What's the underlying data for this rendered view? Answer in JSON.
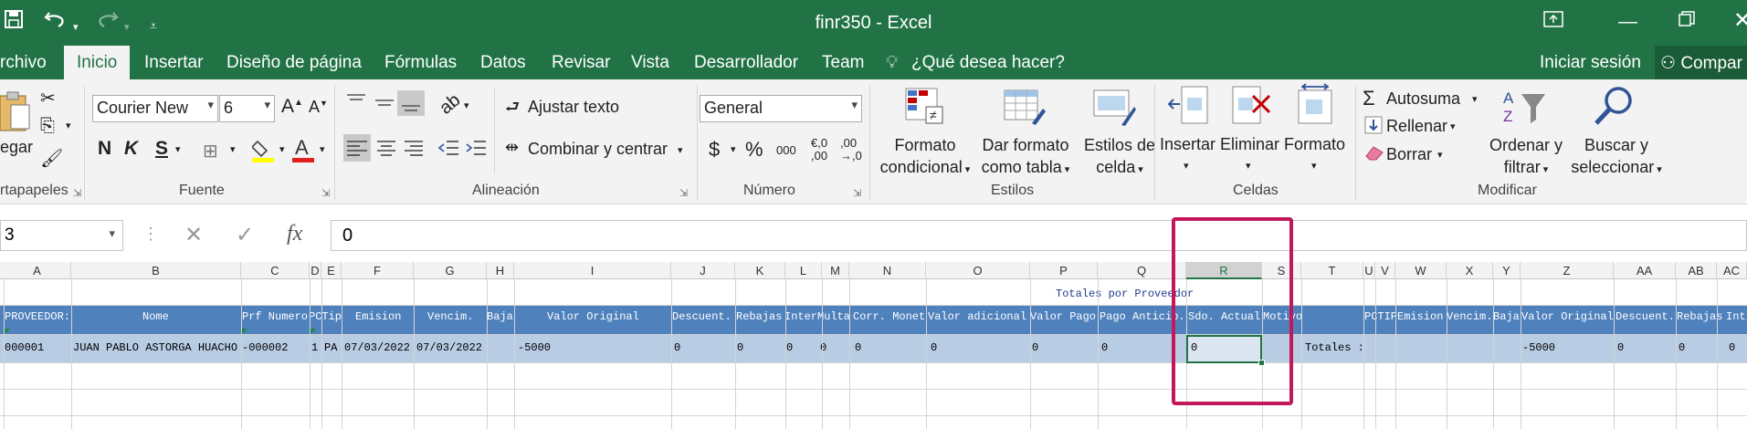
{
  "window": {
    "title": "finr350 - Excel"
  },
  "qat": {
    "save_icon": "save-icon",
    "undo_icon": "undo-icon",
    "redo_icon": "redo-icon",
    "customize_icon": "customize-qat-icon"
  },
  "tabs": [
    {
      "label": "rchivo"
    },
    {
      "label": "Inicio"
    },
    {
      "label": "Insertar"
    },
    {
      "label": "Diseño de página"
    },
    {
      "label": "Fórmulas"
    },
    {
      "label": "Datos"
    },
    {
      "label": "Revisar"
    },
    {
      "label": "Vista"
    },
    {
      "label": "Desarrollador"
    },
    {
      "label": "Team"
    },
    {
      "label": "¿Qué desea hacer?"
    }
  ],
  "account": {
    "signin": "Iniciar sesión",
    "share": "Compar"
  },
  "ribbon": {
    "clipboard": {
      "paste": "egar",
      "label": "rtapapeles"
    },
    "font": {
      "name": "Courier New",
      "size": "6",
      "bold": "N",
      "italic": "K",
      "underline": "S",
      "label": "Fuente"
    },
    "alignment": {
      "wrap": "Ajustar texto",
      "merge": "Combinar y centrar",
      "label": "Alineación"
    },
    "number": {
      "format": "General",
      "currency": "$",
      "percent": "%",
      "thousands": "000",
      "inc_dec_top": "€,0",
      "inc_dec_bottom": ",00",
      "dec_dec_top": ",00",
      "dec_dec_bottom": "→,0",
      "label": "Número"
    },
    "styles": {
      "conditional_1": "Formato",
      "conditional_2": "condicional",
      "table_1": "Dar formato",
      "table_2": "como tabla",
      "cell_1": "Estilos de",
      "cell_2": "celda",
      "label": "Estilos"
    },
    "cells": {
      "insert": "Insertar",
      "delete": "Eliminar",
      "format": "Formato",
      "label": "Celdas"
    },
    "editing": {
      "autosum": "Autosuma",
      "fill": "Rellenar",
      "clear": "Borrar",
      "sort_1": "Ordenar y",
      "sort_2": "filtrar",
      "find_1": "Buscar y",
      "find_2": "seleccionar",
      "label": "Modificar"
    }
  },
  "formula": {
    "namebox": "3",
    "cancel": "✕",
    "enter": "✓",
    "fx": "fx",
    "value": "0"
  },
  "columns": [
    "A",
    "B",
    "C",
    "D",
    "E",
    "F",
    "G",
    "H",
    "I",
    "J",
    "K",
    "L",
    "M",
    "N",
    "O",
    "P",
    "Q",
    "R",
    "S",
    "T",
    "U",
    "V",
    "W",
    "X",
    "Y",
    "Z",
    "AA",
    "AB",
    "AC"
  ],
  "sheet": {
    "title_row": "Totales por Proveedor",
    "header": [
      "PROVEEDOR:",
      "Nome",
      "Prf Numero",
      "PCTip",
      "Emision",
      "Vencim.",
      "Baja",
      "Valor Original",
      "Descuent.",
      "Rebajas",
      "Inter",
      "Multa",
      "Corr. Monet",
      "Valor adicional",
      "Valor Pago",
      "Pago Anticip.",
      "Sdo. Actual",
      "Motivo",
      "PCTIP",
      "Emision",
      "Vencim.",
      "Baja",
      "Valor Original",
      "Descuent.",
      "Rebajas",
      "Int"
    ],
    "data": [
      "000001",
      "JUAN PABLO ASTORGA HUACHO",
      "-000002",
      "1",
      "PA",
      "07/03/2022",
      "07/03/2022",
      "-5000",
      "0",
      "0",
      "0",
      "0",
      "0",
      "0",
      "0",
      "0",
      "0",
      "Totales :",
      "-5000",
      "0",
      "0",
      "0"
    ]
  }
}
